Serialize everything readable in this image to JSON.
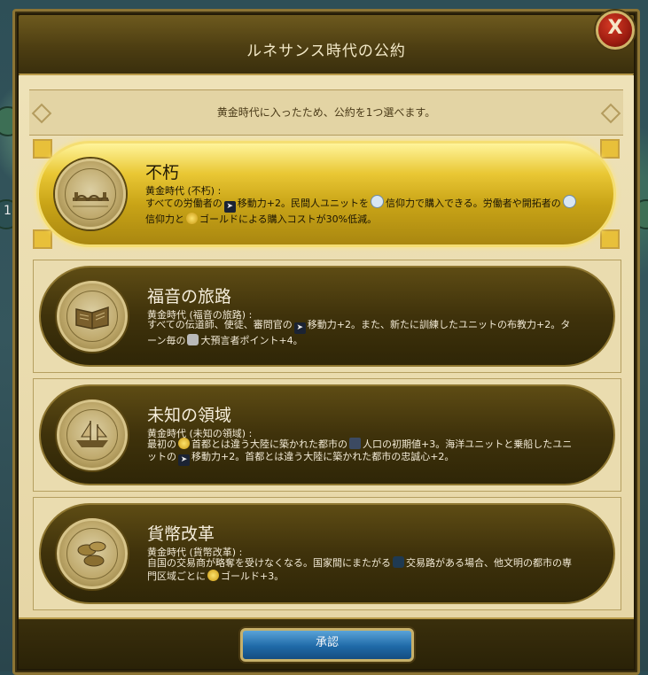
{
  "dialog": {
    "title": "ルネサンス時代の公約",
    "close_label": "X",
    "banner": "黄金時代に入ったため、公約を1つ選べます。",
    "accept_label": "承認"
  },
  "map": {
    "side_label": "1"
  },
  "commitments": [
    {
      "title": "不朽",
      "subtitle": "黄金時代 (不朽) :",
      "desc_parts": [
        "すべての労働者の",
        "移動力+2。民間人ユニットを",
        "信仰力で購入できる。労働者や開拓者の",
        "信仰力と",
        "ゴールドによる購入コストが30%低減。"
      ],
      "icon": "bridge-icon",
      "selected": true
    },
    {
      "title": "福音の旅路",
      "subtitle": "黄金時代 (福音の旅路) :",
      "desc_parts": [
        "すべての伝道師、使徒、審問官の",
        "移動力+2。また、新たに訓練したユニットの布教力+2。ターン毎の",
        "大預言者ポイント+4。"
      ],
      "icon": "book-icon",
      "selected": false
    },
    {
      "title": "未知の領域",
      "subtitle": "黄金時代 (未知の領域) :",
      "desc_parts": [
        "最初の",
        "首都とは違う大陸に築かれた都市の",
        "人口の初期値+3。海洋ユニットと乗船したユニットの",
        "移動力+2。首都とは違う大陸に築かれた都市の忠誠心+2。"
      ],
      "icon": "ship-icon",
      "selected": false
    },
    {
      "title": "貨幣改革",
      "subtitle": "黄金時代 (貨幣改革) :",
      "desc_parts": [
        "自国の交易商が略奪を受けなくなる。国家間にまたがる",
        "交易路がある場合、他文明の都市の専門区域ごとに",
        "ゴールド+3。"
      ],
      "icon": "coins-icon",
      "selected": false
    }
  ]
}
